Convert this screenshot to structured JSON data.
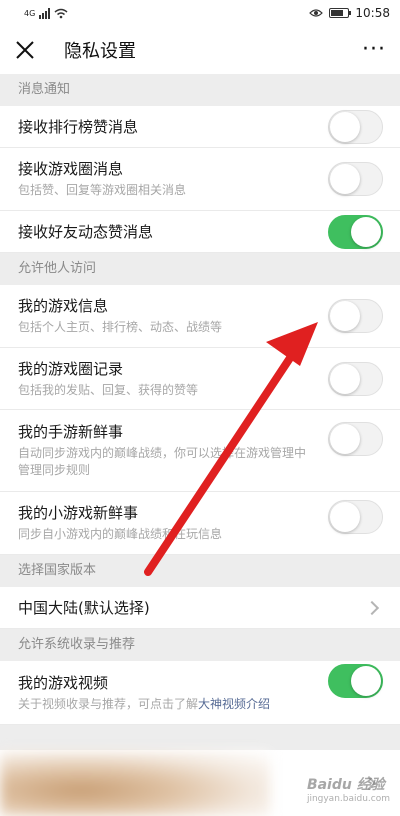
{
  "status_bar": {
    "network": "4G",
    "time": "10:58"
  },
  "header": {
    "title": "隐私设置",
    "more": "···"
  },
  "sections": {
    "notify": {
      "header": "消息通知",
      "rows": [
        {
          "label": "接收排行榜赞消息",
          "desc": "",
          "toggle": "off"
        },
        {
          "label": "接收游戏圈消息",
          "desc": "包括赞、回复等游戏圈相关消息",
          "toggle": "off"
        },
        {
          "label": "接收好友动态赞消息",
          "desc": "",
          "toggle": "on"
        }
      ]
    },
    "access": {
      "header": "允许他人访问",
      "rows": [
        {
          "label": "我的游戏信息",
          "desc": "包括个人主页、排行榜、动态、战绩等",
          "toggle": "off"
        },
        {
          "label": "我的游戏圈记录",
          "desc": "包括我的发贴、回复、获得的赞等",
          "toggle": "off"
        },
        {
          "label": "我的手游新鲜事",
          "desc": "自动同步游戏内的巅峰战绩，你可以选择在游戏管理中管理同步规则",
          "toggle": "off"
        },
        {
          "label": "我的小游戏新鲜事",
          "desc": "同步自小游戏内的巅峰战绩和在玩信息",
          "toggle": "off"
        }
      ]
    },
    "region": {
      "header": "选择国家版本",
      "row_label": "中国大陆(默认选择)"
    },
    "recommend": {
      "header": "允许系统收录与推荐",
      "row_label": "我的游戏视频",
      "desc_prefix": "关于视频收录与推荐，可点击了解",
      "desc_link": "大神视频介绍",
      "toggle": "on"
    }
  },
  "watermark": {
    "brand": "Baidu 经验",
    "url": "jingyan.baidu.com"
  },
  "colors": {
    "toggle_on": "#3fbf5f",
    "link": "#576b95",
    "arrow": "#e02020"
  }
}
